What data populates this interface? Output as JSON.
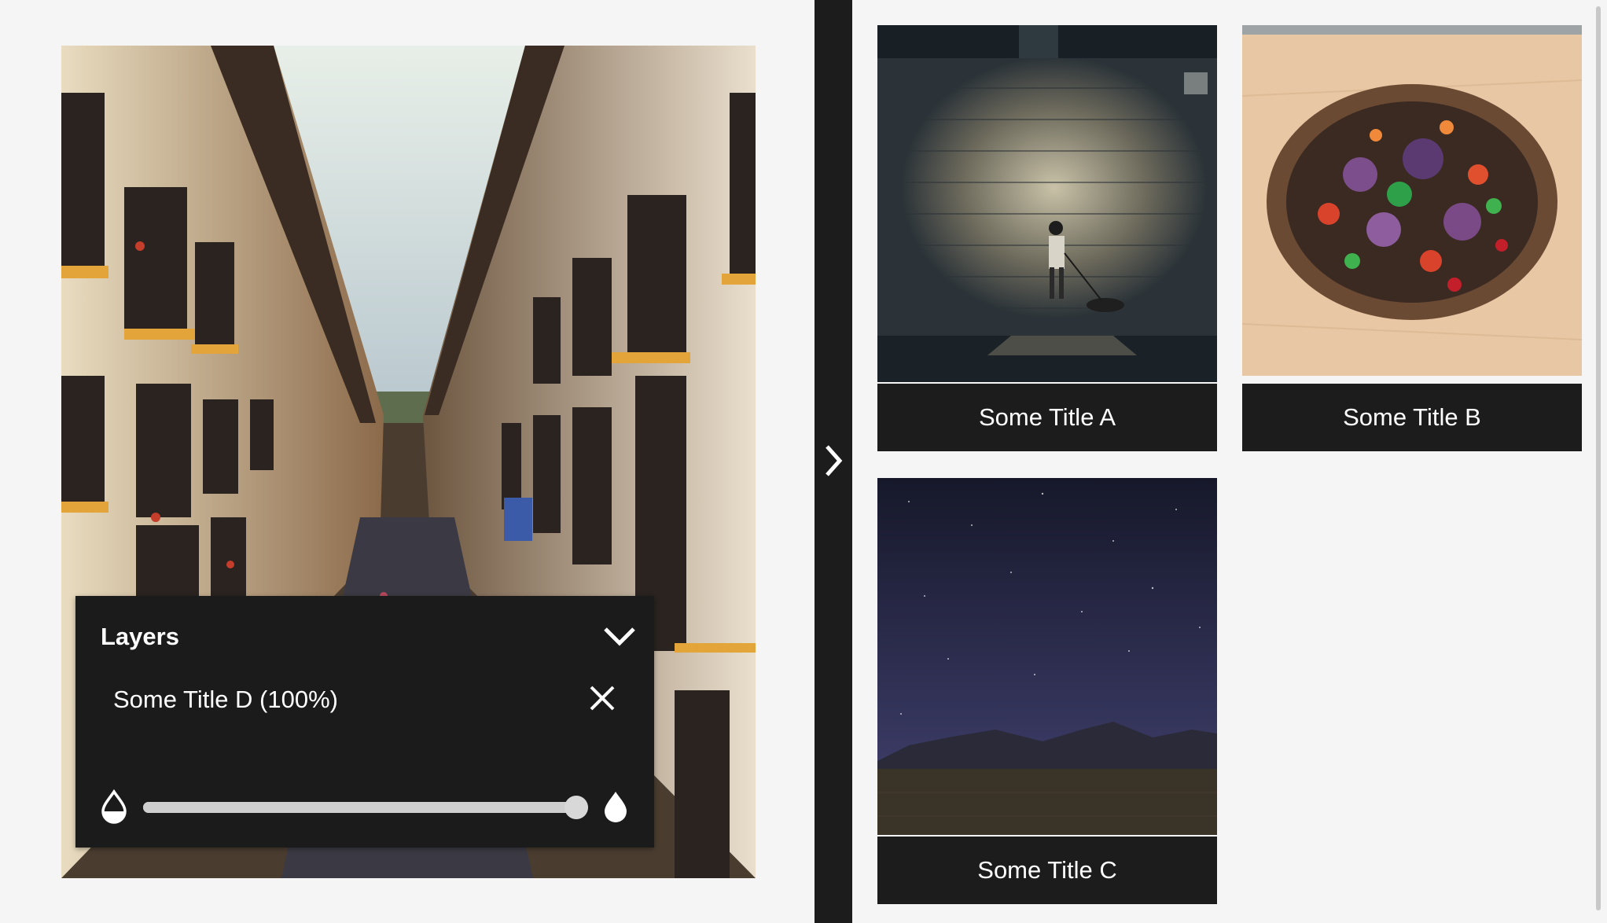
{
  "viewer": {
    "image_icon": "street-photo",
    "layers_panel": {
      "title": "Layers",
      "collapse_icon": "chevron-down-icon",
      "layer": {
        "name": "Some Title D (100%)",
        "remove_icon": "close-icon"
      },
      "opacity": {
        "value_percent": 100,
        "min_icon": "half-drop-icon",
        "max_icon": "drop-icon"
      }
    }
  },
  "divider": {
    "icon": "chevron-right-icon"
  },
  "gallery": {
    "cards": [
      {
        "title": "Some Title A",
        "thumbnail": "person-walking-dog"
      },
      {
        "title": "Some Title B",
        "thumbnail": "salad-bowl"
      },
      {
        "title": "Some Title C",
        "thumbnail": "night-sky"
      }
    ]
  },
  "colors": {
    "background": "#f5f5f5",
    "panel": "#1b1b1b",
    "text_on_dark": "#ffffff",
    "slider": "#cfcfcf"
  }
}
